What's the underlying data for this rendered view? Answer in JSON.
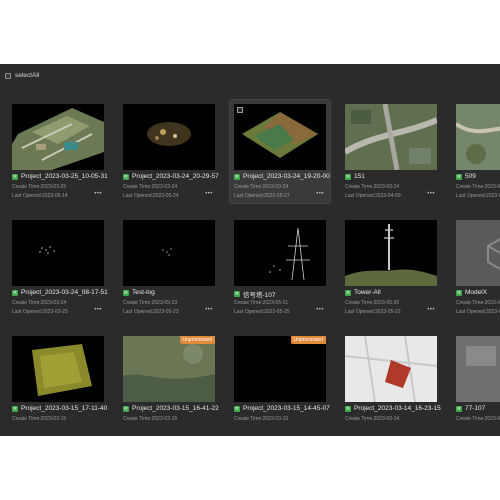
{
  "toolbar": {
    "select_all_label": "selectAll"
  },
  "labels": {
    "create_prefix": "Create Time:",
    "opened_prefix": "Last Opened:",
    "more": "•••",
    "title_icon": "R"
  },
  "badges": {
    "unprocessed": "Unprocessed"
  },
  "projects": [
    {
      "title": "Project_2023-03-25_10-05-31",
      "create": "2023-03-25",
      "opened": "2023-05-14",
      "thumb": "city-aerial"
    },
    {
      "title": "Project_2023-03-24_20-29-57",
      "create": "2023-03-24",
      "opened": "2023-05-24",
      "thumb": "sparse-points"
    },
    {
      "title": "Project_2023-03-24_19-20-00",
      "create": "2023-03-24",
      "opened": "2023-05-27",
      "thumb": "terrain-tile"
    },
    {
      "title": "151",
      "create": "2023-03-24",
      "opened": "2023-04-09",
      "thumb": "highway-aerial"
    },
    {
      "title": "509",
      "create": "2023-0",
      "opened": "2023-0",
      "thumb": "park-aerial"
    },
    {
      "title": "Project_2023-03-24_08-17-51",
      "create": "2023-03-24",
      "opened": "2023-03-25",
      "thumb": "dots"
    },
    {
      "title": "Test-log",
      "create": "2023-05-23",
      "opened": "2023-05-23",
      "thumb": "dots-small"
    },
    {
      "title": "信号塔-107",
      "create": "2023-05-21",
      "opened": "2023-05-25",
      "thumb": "tower-points"
    },
    {
      "title": "Tower-All",
      "create": "2023-05-20",
      "opened": "2023-05-22",
      "thumb": "tower-color"
    },
    {
      "title": "ModelX",
      "create": "2023-0",
      "opened": "2023-0",
      "thumb": "model-icon"
    },
    {
      "title": "Project_2023-03-15_17-11-40",
      "create": "2023-03-15",
      "opened": "",
      "thumb": "yellow-tile"
    },
    {
      "title": "Project_2023-03-15_16-41-22",
      "create": "2023-03-15",
      "opened": "",
      "thumb": "coast-aerial",
      "badge": "Unprocessed"
    },
    {
      "title": "Project_2023-03-15_14-45-07",
      "create": "2023-03-15",
      "opened": "",
      "thumb": "black",
      "badge": "Unprocessed"
    },
    {
      "title": "Project_2023-03-14_16-23-15",
      "create": "2023-03-14",
      "opened": "",
      "thumb": "map-overlay"
    },
    {
      "title": "77-107",
      "create": "2023-0",
      "opened": "",
      "thumb": "gray-aerial"
    }
  ]
}
